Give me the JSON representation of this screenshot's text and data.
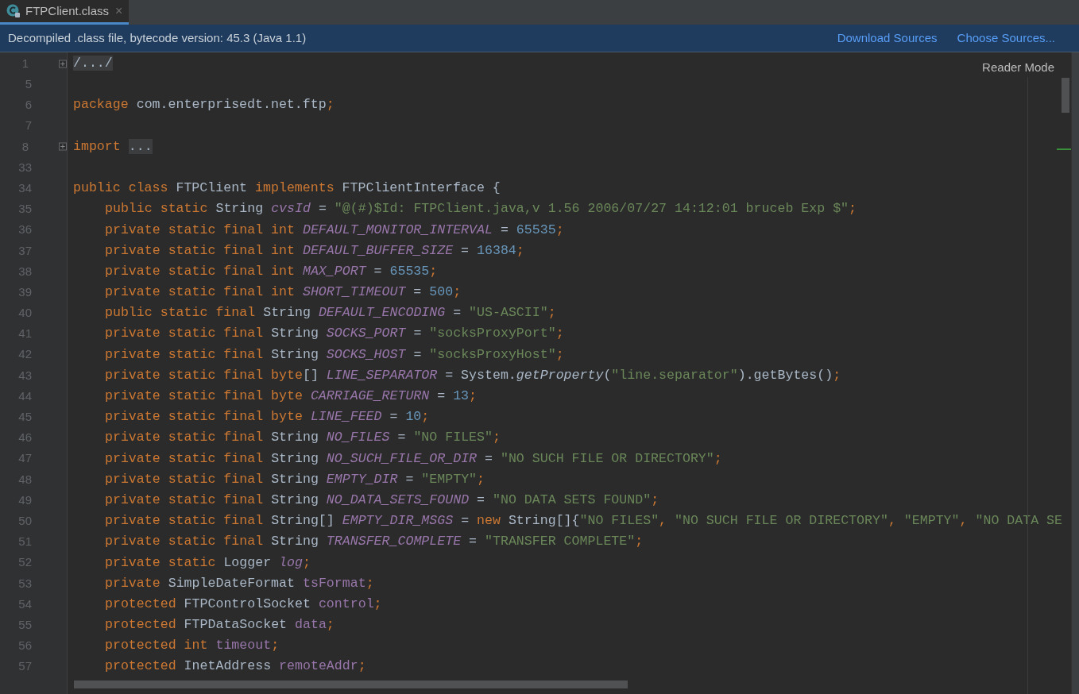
{
  "tab": {
    "title": "FTPClient.class",
    "close": "×",
    "selected": true
  },
  "banner": {
    "message": "Decompiled .class file, bytecode version: 45.3 (Java 1.1)",
    "links": [
      "Download Sources",
      "Choose Sources..."
    ]
  },
  "reader_mode": "Reader Mode",
  "lines": [
    {
      "number": "1",
      "fold_collapsed": true,
      "indented": false,
      "tokens": [
        {
          "kind": "folded",
          "text": "/.../"
        }
      ]
    },
    {
      "number": "5"
    },
    {
      "number": "6",
      "indented": false,
      "tokens": [
        {
          "kind": "keyword",
          "text": "package "
        },
        {
          "kind": "plain",
          "text": "com.enterprisedt.net.ftp"
        },
        {
          "kind": "punct",
          "text": ";"
        }
      ]
    },
    {
      "number": "7"
    },
    {
      "number": "8",
      "fold_collapsed": true,
      "indented": false,
      "tokens": [
        {
          "kind": "keyword",
          "text": "import "
        },
        {
          "kind": "folded",
          "text": "..."
        }
      ]
    },
    {
      "number": "33"
    },
    {
      "number": "34",
      "indented": false,
      "tokens": [
        {
          "kind": "keyword",
          "text": "public class "
        },
        {
          "kind": "plain",
          "text": "FTPClient "
        },
        {
          "kind": "keyword",
          "text": "implements "
        },
        {
          "kind": "plain",
          "text": "FTPClientInterface {"
        }
      ]
    },
    {
      "number": "35",
      "indented": true,
      "tokens": [
        {
          "kind": "keyword",
          "text": "public static "
        },
        {
          "kind": "plain",
          "text": "String "
        },
        {
          "kind": "static_field",
          "text": "cvsId"
        },
        {
          "kind": "plain",
          "text": " = "
        },
        {
          "kind": "string",
          "text": "\"@(#)$Id: FTPClient.java,v 1.56 2006/07/27 14:12:01 bruceb Exp $\""
        },
        {
          "kind": "punct",
          "text": ";"
        }
      ]
    },
    {
      "number": "36",
      "indented": true,
      "tokens": [
        {
          "kind": "keyword",
          "text": "private static final int "
        },
        {
          "kind": "static_field",
          "text": "DEFAULT_MONITOR_INTERVAL"
        },
        {
          "kind": "plain",
          "text": " = "
        },
        {
          "kind": "number",
          "text": "65535"
        },
        {
          "kind": "punct",
          "text": ";"
        }
      ]
    },
    {
      "number": "37",
      "indented": true,
      "tokens": [
        {
          "kind": "keyword",
          "text": "private static final int "
        },
        {
          "kind": "static_field",
          "text": "DEFAULT_BUFFER_SIZE"
        },
        {
          "kind": "plain",
          "text": " = "
        },
        {
          "kind": "number",
          "text": "16384"
        },
        {
          "kind": "punct",
          "text": ";"
        }
      ]
    },
    {
      "number": "38",
      "indented": true,
      "tokens": [
        {
          "kind": "keyword",
          "text": "private static final int "
        },
        {
          "kind": "static_field",
          "text": "MAX_PORT"
        },
        {
          "kind": "plain",
          "text": " = "
        },
        {
          "kind": "number",
          "text": "65535"
        },
        {
          "kind": "punct",
          "text": ";"
        }
      ]
    },
    {
      "number": "39",
      "indented": true,
      "tokens": [
        {
          "kind": "keyword",
          "text": "private static final int "
        },
        {
          "kind": "static_field",
          "text": "SHORT_TIMEOUT"
        },
        {
          "kind": "plain",
          "text": " = "
        },
        {
          "kind": "number",
          "text": "500"
        },
        {
          "kind": "punct",
          "text": ";"
        }
      ]
    },
    {
      "number": "40",
      "indented": true,
      "tokens": [
        {
          "kind": "keyword",
          "text": "public static final "
        },
        {
          "kind": "plain",
          "text": "String "
        },
        {
          "kind": "static_field",
          "text": "DEFAULT_ENCODING"
        },
        {
          "kind": "plain",
          "text": " = "
        },
        {
          "kind": "string",
          "text": "\"US-ASCII\""
        },
        {
          "kind": "punct",
          "text": ";"
        }
      ]
    },
    {
      "number": "41",
      "indented": true,
      "tokens": [
        {
          "kind": "keyword",
          "text": "private static final "
        },
        {
          "kind": "plain",
          "text": "String "
        },
        {
          "kind": "static_field",
          "text": "SOCKS_PORT"
        },
        {
          "kind": "plain",
          "text": " = "
        },
        {
          "kind": "string",
          "text": "\"socksProxyPort\""
        },
        {
          "kind": "punct",
          "text": ";"
        }
      ]
    },
    {
      "number": "42",
      "indented": true,
      "tokens": [
        {
          "kind": "keyword",
          "text": "private static final "
        },
        {
          "kind": "plain",
          "text": "String "
        },
        {
          "kind": "static_field",
          "text": "SOCKS_HOST"
        },
        {
          "kind": "plain",
          "text": " = "
        },
        {
          "kind": "string",
          "text": "\"socksProxyHost\""
        },
        {
          "kind": "punct",
          "text": ";"
        }
      ]
    },
    {
      "number": "43",
      "indented": true,
      "tokens": [
        {
          "kind": "keyword",
          "text": "private static final byte"
        },
        {
          "kind": "plain",
          "text": "[] "
        },
        {
          "kind": "static_field",
          "text": "LINE_SEPARATOR"
        },
        {
          "kind": "plain",
          "text": " = System."
        },
        {
          "kind": "static_method",
          "text": "getProperty"
        },
        {
          "kind": "plain",
          "text": "("
        },
        {
          "kind": "string",
          "text": "\"line.separator\""
        },
        {
          "kind": "plain",
          "text": ").getBytes()"
        },
        {
          "kind": "punct",
          "text": ";"
        }
      ]
    },
    {
      "number": "44",
      "indented": true,
      "tokens": [
        {
          "kind": "keyword",
          "text": "private static final byte "
        },
        {
          "kind": "static_field",
          "text": "CARRIAGE_RETURN"
        },
        {
          "kind": "plain",
          "text": " = "
        },
        {
          "kind": "number",
          "text": "13"
        },
        {
          "kind": "punct",
          "text": ";"
        }
      ]
    },
    {
      "number": "45",
      "indented": true,
      "tokens": [
        {
          "kind": "keyword",
          "text": "private static final byte "
        },
        {
          "kind": "static_field",
          "text": "LINE_FEED"
        },
        {
          "kind": "plain",
          "text": " = "
        },
        {
          "kind": "number",
          "text": "10"
        },
        {
          "kind": "punct",
          "text": ";"
        }
      ]
    },
    {
      "number": "46",
      "indented": true,
      "tokens": [
        {
          "kind": "keyword",
          "text": "private static final "
        },
        {
          "kind": "plain",
          "text": "String "
        },
        {
          "kind": "static_field",
          "text": "NO_FILES"
        },
        {
          "kind": "plain",
          "text": " = "
        },
        {
          "kind": "string",
          "text": "\"NO FILES\""
        },
        {
          "kind": "punct",
          "text": ";"
        }
      ]
    },
    {
      "number": "47",
      "indented": true,
      "tokens": [
        {
          "kind": "keyword",
          "text": "private static final "
        },
        {
          "kind": "plain",
          "text": "String "
        },
        {
          "kind": "static_field",
          "text": "NO_SUCH_FILE_OR_DIR"
        },
        {
          "kind": "plain",
          "text": " = "
        },
        {
          "kind": "string",
          "text": "\"NO SUCH FILE OR DIRECTORY\""
        },
        {
          "kind": "punct",
          "text": ";"
        }
      ]
    },
    {
      "number": "48",
      "indented": true,
      "tokens": [
        {
          "kind": "keyword",
          "text": "private static final "
        },
        {
          "kind": "plain",
          "text": "String "
        },
        {
          "kind": "static_field",
          "text": "EMPTY_DIR"
        },
        {
          "kind": "plain",
          "text": " = "
        },
        {
          "kind": "string",
          "text": "\"EMPTY\""
        },
        {
          "kind": "punct",
          "text": ";"
        }
      ]
    },
    {
      "number": "49",
      "indented": true,
      "tokens": [
        {
          "kind": "keyword",
          "text": "private static final "
        },
        {
          "kind": "plain",
          "text": "String "
        },
        {
          "kind": "static_field",
          "text": "NO_DATA_SETS_FOUND"
        },
        {
          "kind": "plain",
          "text": " = "
        },
        {
          "kind": "string",
          "text": "\"NO DATA SETS FOUND\""
        },
        {
          "kind": "punct",
          "text": ";"
        }
      ]
    },
    {
      "number": "50",
      "indented": true,
      "tokens": [
        {
          "kind": "keyword",
          "text": "private static final "
        },
        {
          "kind": "plain",
          "text": "String[] "
        },
        {
          "kind": "static_field",
          "text": "EMPTY_DIR_MSGS"
        },
        {
          "kind": "plain",
          "text": " = "
        },
        {
          "kind": "keyword",
          "text": "new "
        },
        {
          "kind": "plain",
          "text": "String[]{"
        },
        {
          "kind": "string",
          "text": "\"NO FILES\""
        },
        {
          "kind": "punct",
          "text": ", "
        },
        {
          "kind": "string",
          "text": "\"NO SUCH FILE OR DIRECTORY\""
        },
        {
          "kind": "punct",
          "text": ", "
        },
        {
          "kind": "string",
          "text": "\"EMPTY\""
        },
        {
          "kind": "punct",
          "text": ", "
        },
        {
          "kind": "string",
          "text": "\"NO DATA SE"
        }
      ]
    },
    {
      "number": "51",
      "indented": true,
      "tokens": [
        {
          "kind": "keyword",
          "text": "private static final "
        },
        {
          "kind": "plain",
          "text": "String "
        },
        {
          "kind": "static_field",
          "text": "TRANSFER_COMPLETE"
        },
        {
          "kind": "plain",
          "text": " = "
        },
        {
          "kind": "string",
          "text": "\"TRANSFER COMPLETE\""
        },
        {
          "kind": "punct",
          "text": ";"
        }
      ]
    },
    {
      "number": "52",
      "indented": true,
      "tokens": [
        {
          "kind": "keyword",
          "text": "private static "
        },
        {
          "kind": "plain",
          "text": "Logger "
        },
        {
          "kind": "static_field",
          "text": "log"
        },
        {
          "kind": "punct",
          "text": ";"
        }
      ]
    },
    {
      "number": "53",
      "indented": true,
      "tokens": [
        {
          "kind": "keyword",
          "text": "private "
        },
        {
          "kind": "plain",
          "text": "SimpleDateFormat "
        },
        {
          "kind": "field",
          "text": "tsFormat"
        },
        {
          "kind": "punct",
          "text": ";"
        }
      ]
    },
    {
      "number": "54",
      "indented": true,
      "tokens": [
        {
          "kind": "keyword",
          "text": "protected "
        },
        {
          "kind": "plain",
          "text": "FTPControlSocket "
        },
        {
          "kind": "field",
          "text": "control"
        },
        {
          "kind": "punct",
          "text": ";"
        }
      ]
    },
    {
      "number": "55",
      "indented": true,
      "tokens": [
        {
          "kind": "keyword",
          "text": "protected "
        },
        {
          "kind": "plain",
          "text": "FTPDataSocket "
        },
        {
          "kind": "field",
          "text": "data"
        },
        {
          "kind": "punct",
          "text": ";"
        }
      ]
    },
    {
      "number": "56",
      "indented": true,
      "tokens": [
        {
          "kind": "keyword",
          "text": "protected int "
        },
        {
          "kind": "field",
          "text": "timeout"
        },
        {
          "kind": "punct",
          "text": ";"
        }
      ]
    },
    {
      "number": "57",
      "indented": true,
      "tokens": [
        {
          "kind": "keyword",
          "text": "protected "
        },
        {
          "kind": "plain",
          "text": "InetAddress "
        },
        {
          "kind": "field",
          "text": "remoteAddr"
        },
        {
          "kind": "punct",
          "text": ";"
        }
      ]
    }
  ]
}
